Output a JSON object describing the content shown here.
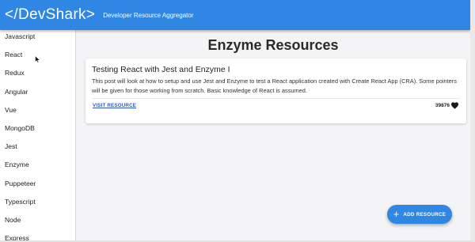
{
  "header": {
    "logo": "</DevShark>",
    "tagline": "Developer Resource Aggregator"
  },
  "sidebar": {
    "items": [
      {
        "label": "Javascript"
      },
      {
        "label": "React"
      },
      {
        "label": "Redux"
      },
      {
        "label": "Angular"
      },
      {
        "label": "Vue"
      },
      {
        "label": "MongoDB"
      },
      {
        "label": "Jest"
      },
      {
        "label": "Enzyme"
      },
      {
        "label": "Puppeteer"
      },
      {
        "label": "Typescript"
      },
      {
        "label": "Node"
      },
      {
        "label": "Express"
      }
    ]
  },
  "main": {
    "title": "Enzyme Resources",
    "card": {
      "title": "Testing React with Jest and Enzyme I",
      "description": "This post will look at how to setup and use Jest and Enzyme to test a React application created with Create React App (CRA). Some pointers will be given for those working from scratch. Basic knowledge of React is assumed.",
      "link_label": "VISIT RESOURCE",
      "likes": "39876",
      "like_icon": "heart-icon"
    },
    "fab": {
      "label": "ADD RESOURCE",
      "icon": "plus-icon"
    }
  },
  "colors": {
    "primary": "#2f86e3",
    "link": "#2d56c6",
    "background": "#f4f4f6"
  }
}
